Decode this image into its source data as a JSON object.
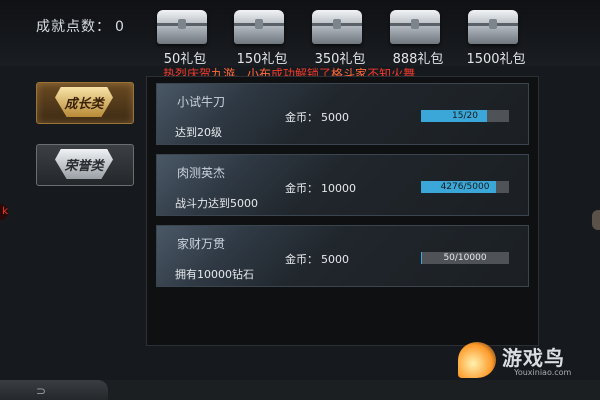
{
  "header": {
    "points_label": "成就点数：",
    "points_value": "0",
    "chests": [
      {
        "label": "50礼包"
      },
      {
        "label": "150礼包"
      },
      {
        "label": "350礼包"
      },
      {
        "label": "888礼包"
      },
      {
        "label": "1500礼包"
      }
    ]
  },
  "ticker": {
    "prefix": "热烈庆贺",
    "player": "九游、小布",
    "mid": "成功解锁了",
    "achievement": "格斗家",
    "suffix": "不知火舞"
  },
  "sidebar": {
    "growth_label": "成长类",
    "honor_label": "荣誉类"
  },
  "left_edge_glyph": "k",
  "achievements": [
    {
      "name": "小试牛刀",
      "reward_label": "金币：",
      "reward_value": "5000",
      "condition": "达到20级",
      "progress_text": "15/20",
      "progress_fraction": 0.75
    },
    {
      "name": "肉测英杰",
      "reward_label": "金币：",
      "reward_value": "10000",
      "condition": "战斗力达到5000",
      "progress_text": "4276/5000",
      "progress_fraction": 0.855
    },
    {
      "name": "家财万贯",
      "reward_label": "金币：",
      "reward_value": "5000",
      "condition": "拥有10000钻石",
      "progress_text": "50/10000",
      "progress_fraction": 0.005
    }
  ],
  "footer": {
    "back_glyph": "⊃"
  },
  "watermark": {
    "title": "游戏鸟",
    "sub": "Youxiniao.com"
  },
  "colors": {
    "progress_fill": "#3aa7d8",
    "ticker_red": "#f03a2c"
  }
}
